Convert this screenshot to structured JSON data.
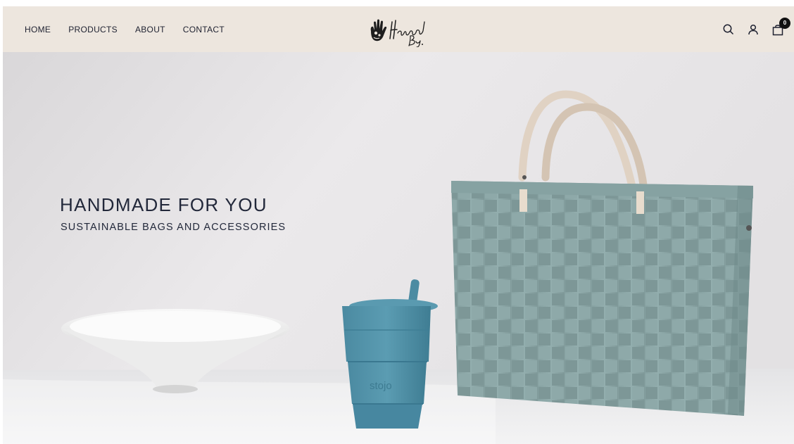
{
  "nav": {
    "items": [
      {
        "label": "HOME"
      },
      {
        "label": "PRODUCTS"
      },
      {
        "label": "ABOUT"
      },
      {
        "label": "CONTACT"
      }
    ]
  },
  "brand": {
    "logo_text": "Handed By",
    "logo_icon": "hand-icon"
  },
  "header_icons": {
    "search": "search-icon",
    "account": "user-icon",
    "cart": "bag-icon",
    "cart_count": "0"
  },
  "hero": {
    "headline": "HANDMADE FOR YOU",
    "subheadline": "SUSTAINABLE BAGS AND ACCESSORIES",
    "cup_brand": "stojo"
  },
  "colors": {
    "header_bg": "#ede6de",
    "text": "#22283a",
    "bag": "#8faaa9",
    "cup": "#4f8fa6"
  }
}
